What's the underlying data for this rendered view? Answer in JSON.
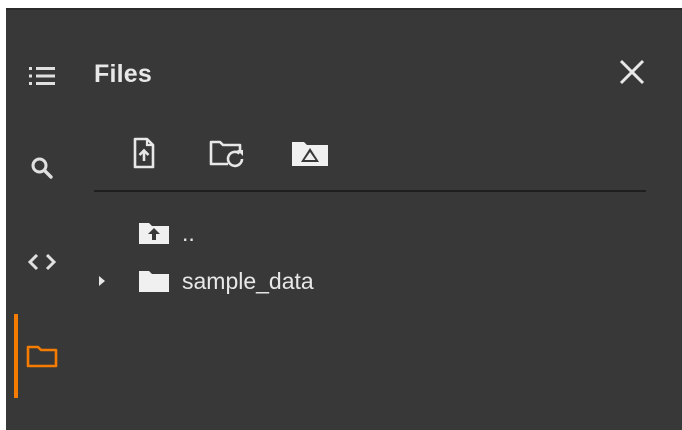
{
  "panel": {
    "title": "Files"
  },
  "rail": {
    "items": [
      {
        "icon": "toc-icon",
        "active": false
      },
      {
        "icon": "search-icon",
        "active": false
      },
      {
        "icon": "code-icon",
        "active": false
      },
      {
        "icon": "folder-icon",
        "active": true
      }
    ]
  },
  "toolbar": {
    "items": [
      {
        "icon": "upload-file-icon"
      },
      {
        "icon": "refresh-folder-icon"
      },
      {
        "icon": "mount-drive-icon"
      }
    ]
  },
  "tree": {
    "items": [
      {
        "label": "..",
        "icon": "folder-up-icon",
        "expandable": false
      },
      {
        "label": "sample_data",
        "icon": "folder-icon",
        "expandable": true
      }
    ]
  },
  "colors": {
    "background": "#383838",
    "text": "#e8e8e8",
    "accent": "#f57c00",
    "divider": "#1f1f1f"
  }
}
